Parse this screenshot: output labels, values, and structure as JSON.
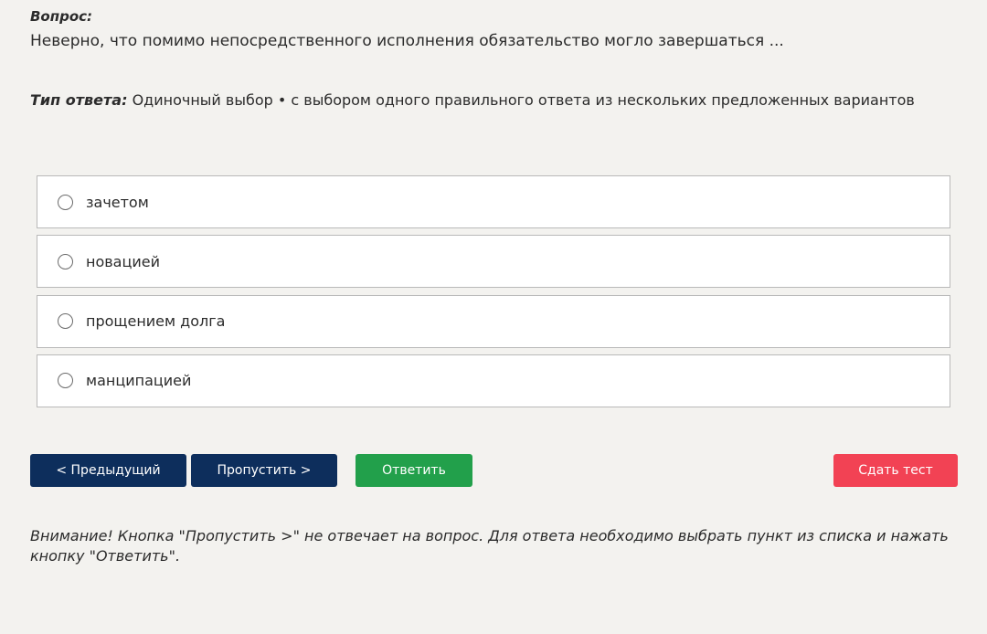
{
  "question": {
    "label": "Вопрос:",
    "text": "Неверно, что помимо непосредственного исполнения обязательство могло завершаться ..."
  },
  "answer_type": {
    "label": "Тип ответа:",
    "value": "Одиночный выбор • с выбором одного правильного ответа из нескольких предложенных вариантов"
  },
  "options": [
    {
      "label": "зачетом",
      "selected": false
    },
    {
      "label": "новацией",
      "selected": false
    },
    {
      "label": "прощением долга",
      "selected": false
    },
    {
      "label": "манципацией",
      "selected": false
    }
  ],
  "buttons": {
    "prev": "< Предыдущий",
    "skip": "Пропустить >",
    "answer": "Ответить",
    "submit": "Сдать тест"
  },
  "notice": "Внимание! Кнопка \"Пропустить >\" не отвечает на вопрос. Для ответа необходимо выбрать пункт из списка и нажать кнопку \"Ответить\".",
  "colors": {
    "background": "#f3f2ef",
    "primary_button": "#0d2e5c",
    "answer_button": "#22a04b",
    "submit_button": "#f24254"
  }
}
